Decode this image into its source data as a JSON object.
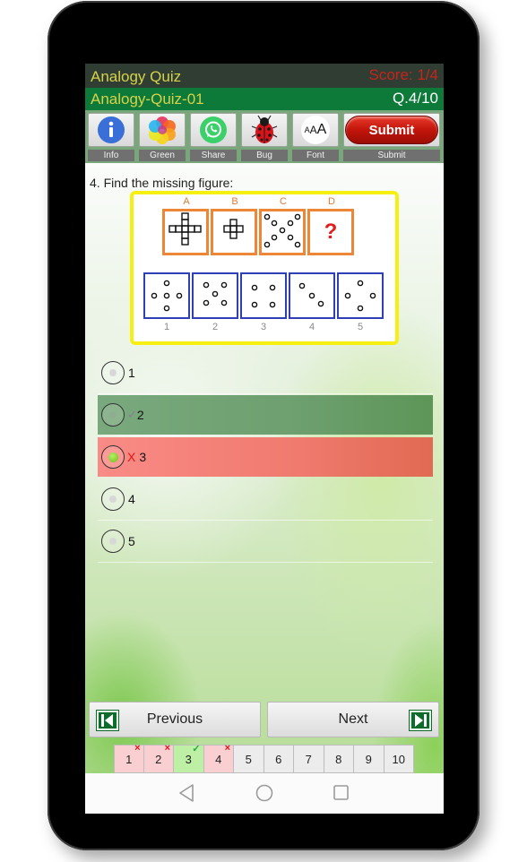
{
  "header": {
    "app_title": "Analogy Quiz",
    "score": "Score: 1/4",
    "quiz_name": "Analogy-Quiz-01",
    "question_counter": "Q.4/10"
  },
  "toolbar": {
    "items": [
      {
        "label": "Info",
        "icon": "info-icon"
      },
      {
        "label": "Green",
        "icon": "theme-color-icon"
      },
      {
        "label": "Share",
        "icon": "share-icon"
      },
      {
        "label": "Bug",
        "icon": "bug-icon"
      },
      {
        "label": "Font",
        "icon": "font-size-icon",
        "glyph": "AAA"
      },
      {
        "label": "Submit",
        "button_text": "Submit"
      }
    ]
  },
  "question": {
    "text": "4. Find the missing figure:",
    "figure_labels": [
      "A",
      "B",
      "C",
      "D"
    ],
    "missing_glyph": "?",
    "option_labels": [
      "1",
      "2",
      "3",
      "4",
      "5"
    ]
  },
  "answers": [
    {
      "label": "1",
      "state": "none",
      "mark": ""
    },
    {
      "label": "2",
      "state": "correct",
      "mark": "✓"
    },
    {
      "label": "3",
      "state": "wrong-selected",
      "mark": "X"
    },
    {
      "label": "4",
      "state": "none",
      "mark": ""
    },
    {
      "label": "5",
      "state": "none",
      "mark": ""
    }
  ],
  "navigation": {
    "previous_label": "Previous",
    "next_label": "Next"
  },
  "pager": [
    {
      "label": "1",
      "status": "wrong",
      "mark": "×"
    },
    {
      "label": "2",
      "status": "wrong",
      "mark": "×"
    },
    {
      "label": "3",
      "status": "correct",
      "mark": "✓"
    },
    {
      "label": "4",
      "status": "wrong",
      "mark": "×"
    },
    {
      "label": "5",
      "status": "unanswered",
      "mark": ""
    },
    {
      "label": "6",
      "status": "unanswered",
      "mark": ""
    },
    {
      "label": "7",
      "status": "unanswered",
      "mark": ""
    },
    {
      "label": "8",
      "status": "unanswered",
      "mark": ""
    },
    {
      "label": "9",
      "status": "unanswered",
      "mark": ""
    },
    {
      "label": "10",
      "status": "unanswered",
      "mark": ""
    }
  ],
  "colors": {
    "title_bar": "#2f3d32",
    "sub_bar": "#0d7a3a",
    "title_text": "#d6d24a",
    "score_text": "#c8241c",
    "correct_row": "#6d9f6f",
    "wrong_row": "#f07a6e"
  }
}
